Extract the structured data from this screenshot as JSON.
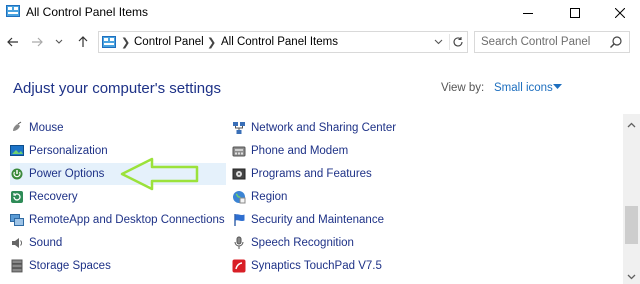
{
  "window": {
    "title": "All Control Panel Items",
    "icon": "control-panel-icon"
  },
  "address": {
    "crumbs": [
      "Control Panel",
      "All Control Panel Items"
    ],
    "search_placeholder": "Search Control Panel"
  },
  "header": {
    "title": "Adjust your computer's settings",
    "view_by_label": "View by:",
    "view_by_value": "Small icons"
  },
  "items_left": [
    {
      "label": "Mouse",
      "icon": "mouse-icon"
    },
    {
      "label": "Personalization",
      "icon": "personalization-icon"
    },
    {
      "label": "Power Options",
      "icon": "power-options-icon"
    },
    {
      "label": "Recovery",
      "icon": "recovery-icon"
    },
    {
      "label": "RemoteApp and Desktop Connections",
      "icon": "remoteapp-icon"
    },
    {
      "label": "Sound",
      "icon": "sound-icon"
    },
    {
      "label": "Storage Spaces",
      "icon": "storage-spaces-icon"
    }
  ],
  "items_right": [
    {
      "label": "Network and Sharing Center",
      "icon": "network-icon"
    },
    {
      "label": "Phone and Modem",
      "icon": "phone-modem-icon"
    },
    {
      "label": "Programs and Features",
      "icon": "programs-icon"
    },
    {
      "label": "Region",
      "icon": "region-icon"
    },
    {
      "label": "Security and Maintenance",
      "icon": "security-flag-icon"
    },
    {
      "label": "Speech Recognition",
      "icon": "microphone-icon"
    },
    {
      "label": "Synaptics TouchPad V7.5",
      "icon": "touchpad-icon"
    }
  ],
  "colors": {
    "link": "#1e3287",
    "accent": "#1e6fbf",
    "selected_bg": "#e5f1fb",
    "arrow": "#9be23b"
  }
}
